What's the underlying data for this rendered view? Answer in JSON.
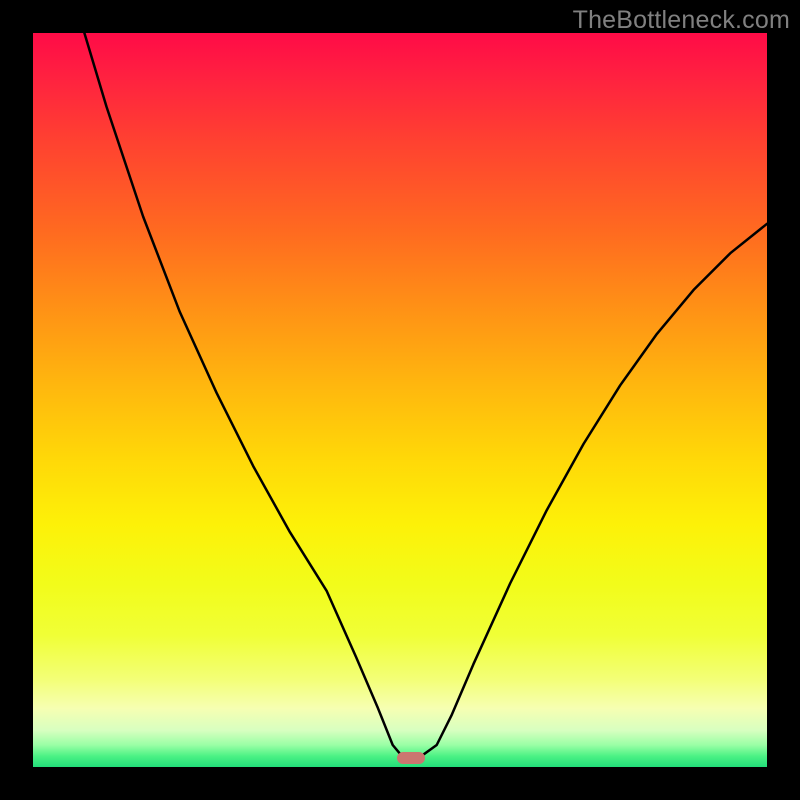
{
  "watermark": "TheBottleneck.com",
  "chart_data": {
    "type": "line",
    "title": "",
    "xlabel": "",
    "ylabel": "",
    "xlim": [
      0,
      100
    ],
    "ylim": [
      0,
      100
    ],
    "series": [
      {
        "name": "bottleneck-curve",
        "x": [
          7,
          10,
          15,
          20,
          25,
          30,
          35,
          40,
          44,
          47,
          49,
          50.5,
          52.5,
          55,
          57,
          60,
          65,
          70,
          75,
          80,
          85,
          90,
          95,
          100
        ],
        "values": [
          100,
          90,
          75,
          62,
          51,
          41,
          32,
          24,
          15,
          8,
          3,
          1.2,
          1.2,
          3,
          7,
          14,
          25,
          35,
          44,
          52,
          59,
          65,
          70,
          74
        ]
      }
    ],
    "marker": {
      "x": 51.5,
      "y_value": 1.2
    },
    "gradient_colors": {
      "top": "#ff0b47",
      "mid_high": "#ff9315",
      "mid": "#fdf108",
      "mid_low": "#f3ff76",
      "bottom": "#22dd7a"
    }
  }
}
